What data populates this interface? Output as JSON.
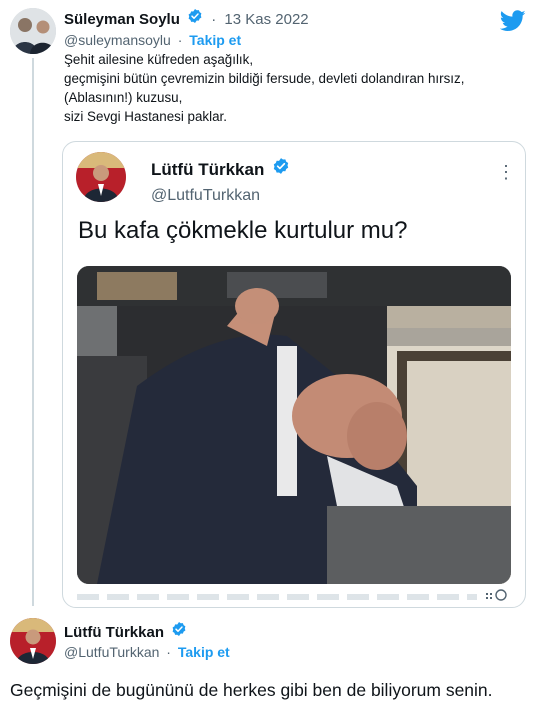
{
  "tweet1": {
    "name": "Süleyman Soylu",
    "handle": "@suleymansoylu",
    "dot": "·",
    "follow": "Takip et",
    "date_sep": "·",
    "date": "13 Kas 2022",
    "text_lines": [
      "Şehit ailesine küfreden aşağılık,",
      "geçmişini bütün çevremizin bildiği fersude, devleti dolandıran hırsız,",
      "(Ablasının!) kuzusu,",
      "sizi Sevgi Hastanesi paklar."
    ]
  },
  "quoted": {
    "name": "Lütfü Türkkan",
    "handle": "@LutfuTurkkan",
    "more": "⋮",
    "text": "Bu kafa çökmekle kurtulur mu?"
  },
  "tweet2": {
    "name": "Lütfü Türkkan",
    "handle": "@LutfuTurkkan",
    "dot": "·",
    "follow": "Takip et",
    "text": "Geçmişini de bugününü de herkes gibi ben de biliyorum senin."
  },
  "colors": {
    "accent": "#1d9bf0",
    "text": "#0f1419",
    "muted": "#536471",
    "border": "#cfd9de"
  }
}
